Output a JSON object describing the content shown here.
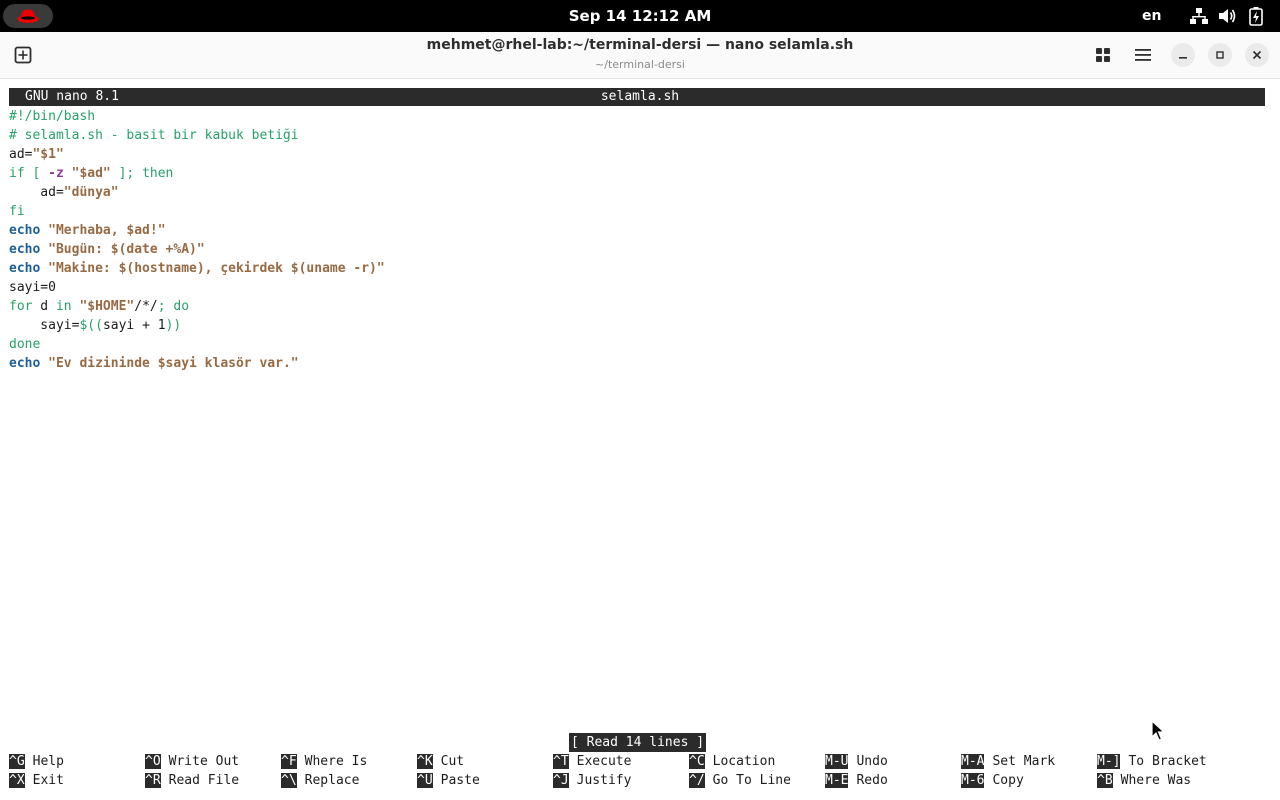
{
  "topbar": {
    "clock": "Sep 14  12:12 AM",
    "lang": "en",
    "icons": [
      "redhat-logo-icon",
      "network-icon",
      "volume-icon",
      "battery-icon"
    ]
  },
  "window": {
    "title": "mehmet@rhel-lab:~/terminal-dersi — nano selamla.sh",
    "subtitle": "~/terminal-dersi"
  },
  "nano": {
    "version": "GNU nano 8.1",
    "filename": "selamla.sh",
    "status": "[ Read 14 lines ]",
    "code_lines": [
      [
        {
          "t": "#!/bin/bash",
          "c": "c-green"
        }
      ],
      [
        {
          "t": "# selamla.sh - basit bir kabuk betiği",
          "c": "c-green"
        }
      ],
      [
        {
          "t": "ad=",
          "c": "c-plain"
        },
        {
          "t": "\"$1\"",
          "c": "c-brown"
        }
      ],
      [
        {
          "t": "if [ ",
          "c": "c-green"
        },
        {
          "t": "-z",
          "c": "c-purple"
        },
        {
          "t": " ",
          "c": "c-plain"
        },
        {
          "t": "\"$ad\"",
          "c": "c-brown"
        },
        {
          "t": " ]; then",
          "c": "c-green"
        }
      ],
      [
        {
          "t": "    ad=",
          "c": "c-plain"
        },
        {
          "t": "\"dünya\"",
          "c": "c-brown"
        }
      ],
      [
        {
          "t": "fi",
          "c": "c-green"
        }
      ],
      [
        {
          "t": "echo",
          "c": "c-blue"
        },
        {
          "t": " ",
          "c": "c-plain"
        },
        {
          "t": "\"Merhaba, $ad!\"",
          "c": "c-brown"
        }
      ],
      [
        {
          "t": "echo",
          "c": "c-blue"
        },
        {
          "t": " ",
          "c": "c-plain"
        },
        {
          "t": "\"Bugün: $(date +%A)\"",
          "c": "c-brown"
        }
      ],
      [
        {
          "t": "echo",
          "c": "c-blue"
        },
        {
          "t": " ",
          "c": "c-plain"
        },
        {
          "t": "\"Makine: $(hostname), çekirdek $(uname -r)\"",
          "c": "c-brown"
        }
      ],
      [
        {
          "t": "sayi=0",
          "c": "c-plain"
        }
      ],
      [
        {
          "t": "for",
          "c": "c-green"
        },
        {
          "t": " d ",
          "c": "c-plain"
        },
        {
          "t": "in",
          "c": "c-green"
        },
        {
          "t": " ",
          "c": "c-plain"
        },
        {
          "t": "\"$HOME\"",
          "c": "c-brown"
        },
        {
          "t": "/*/",
          "c": "c-plain"
        },
        {
          "t": "; do",
          "c": "c-green"
        }
      ],
      [
        {
          "t": "    sayi=",
          "c": "c-plain"
        },
        {
          "t": "$((",
          "c": "c-green"
        },
        {
          "t": "sayi + 1",
          "c": "c-plain"
        },
        {
          "t": "))",
          "c": "c-green"
        }
      ],
      [
        {
          "t": "done",
          "c": "c-green"
        }
      ],
      [
        {
          "t": "echo",
          "c": "c-blue"
        },
        {
          "t": " ",
          "c": "c-plain"
        },
        {
          "t": "\"Ev dizininde $sayi klasör var.\"",
          "c": "c-brown"
        }
      ]
    ],
    "shortcuts": [
      {
        "key": "^G",
        "label": "Help",
        "col": 0,
        "row": 0
      },
      {
        "key": "^X",
        "label": "Exit",
        "col": 0,
        "row": 1
      },
      {
        "key": "^O",
        "label": "Write Out",
        "col": 1,
        "row": 0
      },
      {
        "key": "^R",
        "label": "Read File",
        "col": 1,
        "row": 1
      },
      {
        "key": "^F",
        "label": "Where Is",
        "col": 2,
        "row": 0
      },
      {
        "key": "^\\",
        "label": "Replace",
        "col": 2,
        "row": 1
      },
      {
        "key": "^K",
        "label": "Cut",
        "col": 3,
        "row": 0
      },
      {
        "key": "^U",
        "label": "Paste",
        "col": 3,
        "row": 1
      },
      {
        "key": "^T",
        "label": "Execute",
        "col": 4,
        "row": 0
      },
      {
        "key": "^J",
        "label": "Justify",
        "col": 4,
        "row": 1
      },
      {
        "key": "^C",
        "label": "Location",
        "col": 5,
        "row": 0
      },
      {
        "key": "^/",
        "label": "Go To Line",
        "col": 5,
        "row": 1
      },
      {
        "key": "M-U",
        "label": "Undo",
        "col": 6,
        "row": 0
      },
      {
        "key": "M-E",
        "label": "Redo",
        "col": 6,
        "row": 1
      },
      {
        "key": "M-A",
        "label": "Set Mark",
        "col": 7,
        "row": 0
      },
      {
        "key": "M-6",
        "label": "Copy",
        "col": 7,
        "row": 1
      },
      {
        "key": "M-]",
        "label": "To Bracket",
        "col": 8,
        "row": 0
      },
      {
        "key": "^B",
        "label": "Where Was",
        "col": 8,
        "row": 1
      }
    ]
  }
}
